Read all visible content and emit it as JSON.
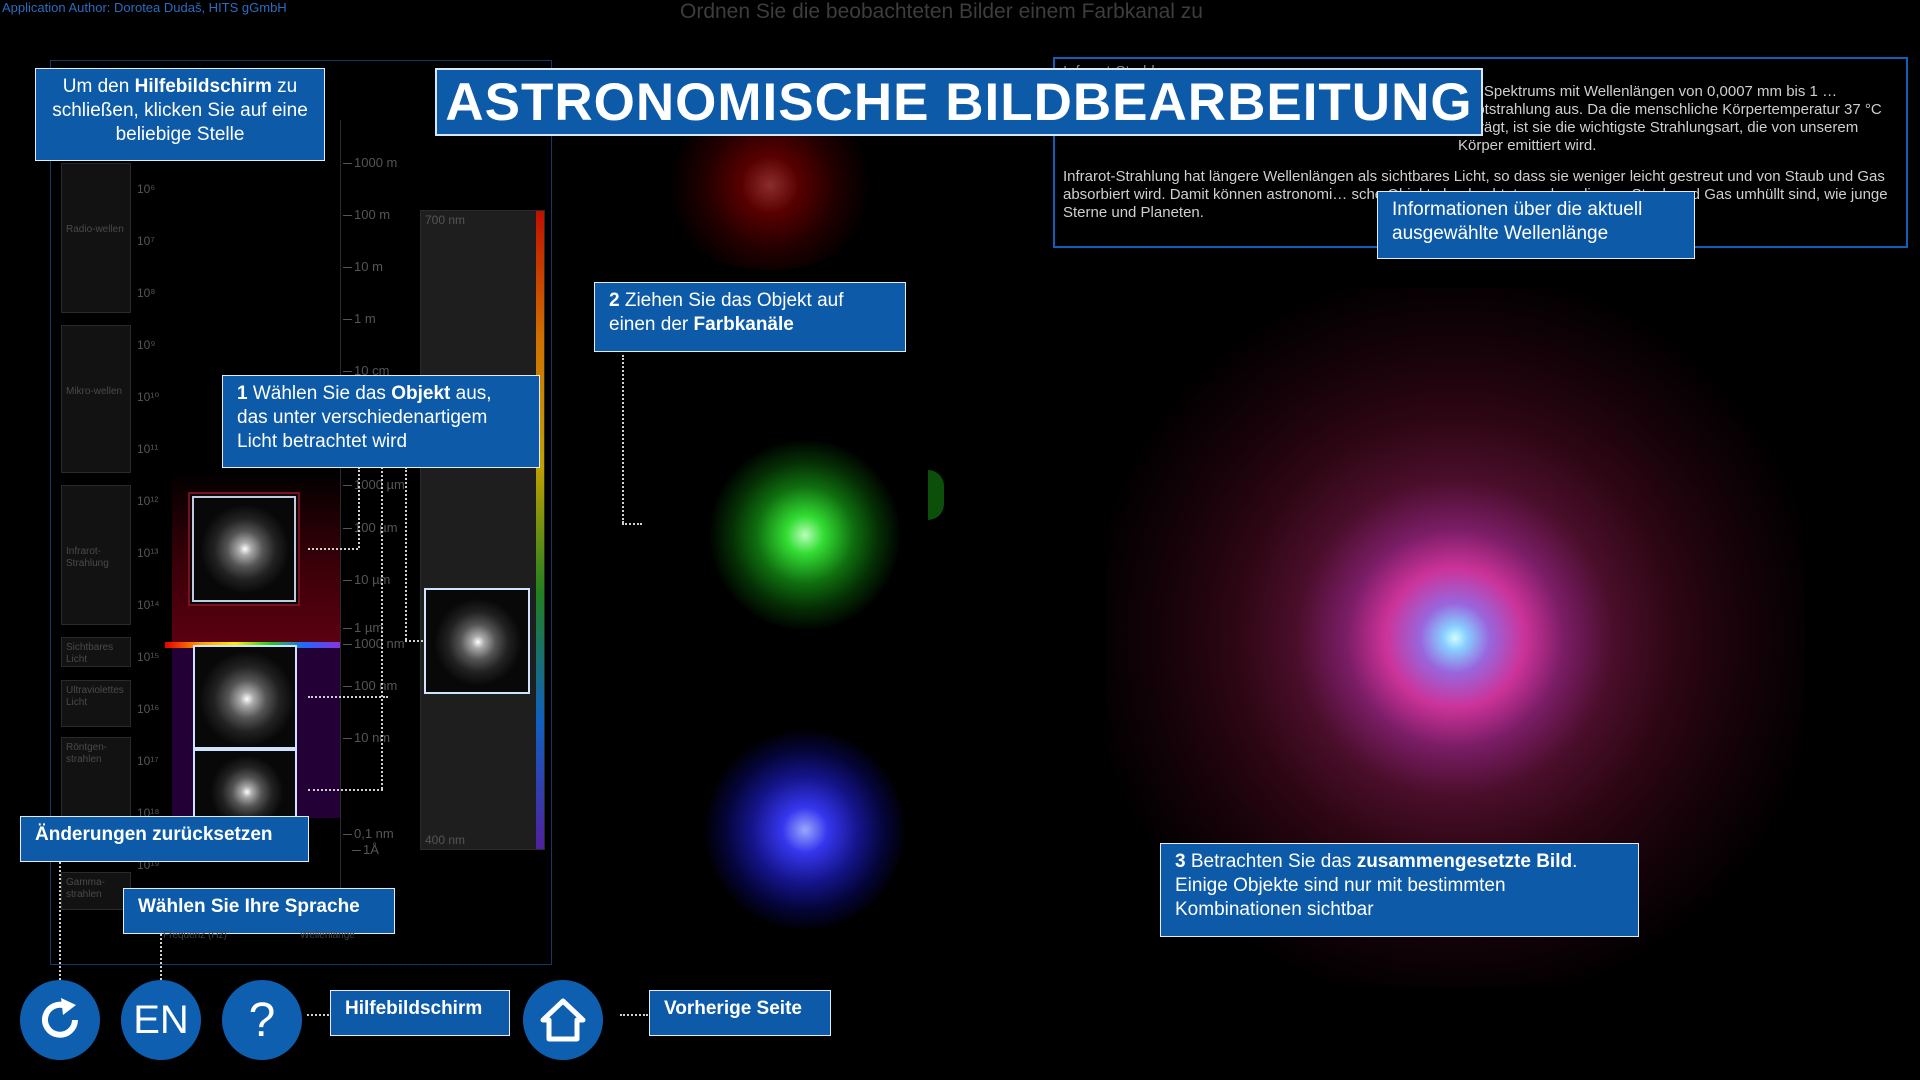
{
  "header": {
    "author": "Application Author: Dorotea Dudaš, HITS gGmbH",
    "instruction": "Ordnen Sie die beobachteten Bilder einem Farbkanal zu"
  },
  "title": "ASTRONOMISCHE BILDBEARBEITUNG",
  "info_panel": {
    "heading": "Infrarot-Strahlung",
    "para1": "ren Spektrums mit Wellenlängen von 0,0007 mm bis 1 … rarotstrahlung aus. Da die menschliche Körpertemperatur 37 °C beträgt, ist sie die wichtigste Strahlungsart, die von unserem Körper emittiert wird.",
    "para2": "Infrarot-Strahlung hat längere Wellenlängen als sichtbares Licht, so dass sie weniger leicht gestreut und von Staub und Gas absorbiert wird. Damit können astronomi… sche Objekte beobachtet werden, die von Staub und Gas umhüllt sind, wie junge Sterne und Planeten."
  },
  "help": {
    "close_pre": "Um den ",
    "close_bold": "Hilfebildschirm",
    "close_post": " zu schließen, klicken Sie auf eine beliebige Stelle",
    "info_wavelength": "Informationen über die aktuell ausgewählte Wellenlänge",
    "step1_num": "1",
    "step1_a": " Wählen Sie das ",
    "step1_bold": "Objekt",
    "step1_b": " aus, das unter verschiedenartigem Licht betrachtet wird",
    "step2_num": "2",
    "step2_a": " Ziehen Sie das Objekt auf einen der ",
    "step2_bold": "Farbkanäle",
    "step3_num": "3",
    "step3_a": " Betrachten Sie das ",
    "step3_bold": "zusammengesetzte Bild",
    "step3_b": ". Einige Objekte sind nur mit bestimmten Kombinationen sichtbar",
    "reset": "Änderungen zurücksetzen",
    "language": "Wählen Sie Ihre Sprache",
    "helpscreen": "Hilfebildschirm",
    "previous": "Vorherige Seite"
  },
  "spectrum": {
    "bands": [
      {
        "label": "Radio-wellen"
      },
      {
        "label": "Mikro-wellen"
      },
      {
        "label": "Infrarot-Strahlung"
      },
      {
        "label": "Sichtbares Licht"
      },
      {
        "label": "Ultraviolettes Licht"
      },
      {
        "label": "Röntgen-strahlen"
      },
      {
        "label": "Gamma-strahlen"
      }
    ],
    "freq_ticks": [
      "10⁶",
      "10⁷",
      "10⁸",
      "10⁹",
      "10¹⁰",
      "10¹¹",
      "10¹²",
      "10¹³",
      "10¹⁴",
      "10¹⁵",
      "10¹⁶",
      "10¹⁷",
      "10¹⁸",
      "10¹⁹"
    ],
    "wave_ticks": [
      "1000 m",
      "100 m",
      "10 m",
      "1 m",
      "10 cm",
      "1000 µm",
      "100 µm",
      "10 µm",
      "1 µm",
      "1000 nm",
      "100 nm",
      "10 nm",
      "0,1 nm",
      "1Å"
    ],
    "tall_top": "700 nm",
    "tall_bottom": "400 nm",
    "x_freq_label": "Frequenz (Hz)",
    "x_wave_label": "Wellenlänge"
  },
  "buttons": {
    "reset_icon": "refresh-icon",
    "language_code": "EN",
    "help_glyph": "?",
    "home_icon": "home-icon"
  },
  "colors": {
    "accent": "#0d5aa8",
    "button": "#0e5fb0",
    "panel_border": "#1060b8"
  }
}
